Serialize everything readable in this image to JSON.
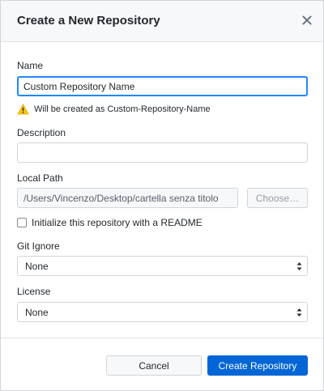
{
  "dialog": {
    "title": "Create a New Repository"
  },
  "name_field": {
    "label": "Name",
    "value": "Custom Repository Name"
  },
  "warning": {
    "text": "Will be created as Custom-Repository-Name",
    "color": "#f9c513"
  },
  "description_field": {
    "label": "Description",
    "value": ""
  },
  "local_path": {
    "label": "Local Path",
    "value": "/Users/Vincenzo/Desktop/cartella senza titolo",
    "choose_label": "Choose…"
  },
  "readme": {
    "label": "Initialize this repository with a README",
    "checked": false
  },
  "git_ignore": {
    "label": "Git Ignore",
    "selected": "None"
  },
  "license": {
    "label": "License",
    "selected": "None"
  },
  "footer": {
    "cancel_label": "Cancel",
    "create_label": "Create Repository"
  },
  "colors": {
    "accent": "#0366d6",
    "focus": "#2188ff"
  }
}
